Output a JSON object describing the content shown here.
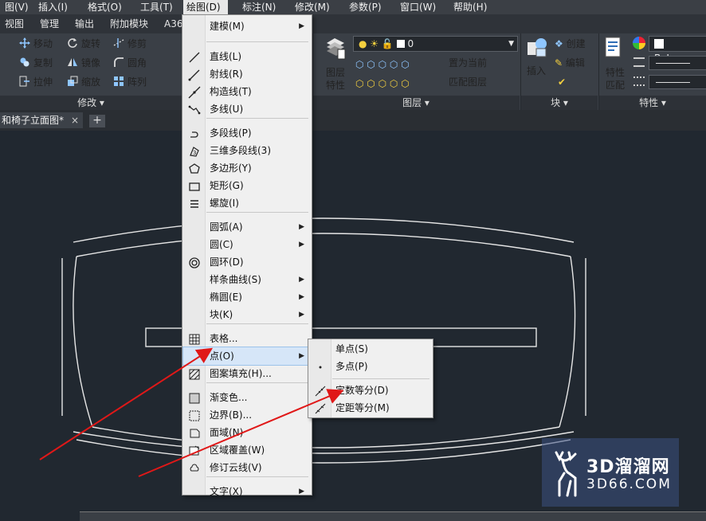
{
  "menubar": {
    "items": [
      "图(V)",
      "插入(I)",
      "格式(O)",
      "工具(T)",
      "绘图(D)",
      "标注(N)",
      "修改(M)",
      "参数(P)",
      "窗口(W)",
      "帮助(H)"
    ]
  },
  "ribbon_tabs": [
    "视图",
    "管理",
    "输出",
    "附加模块",
    "A36"
  ],
  "ribbon": {
    "modify": {
      "move": "移动",
      "rotate": "旋转",
      "trim": "修剪",
      "copy": "复制",
      "mirror": "镜像",
      "fillet": "圆角",
      "stretch": "拉伸",
      "scale": "缩放",
      "array": "阵列",
      "panel_label": "修改 ▾"
    },
    "layers": {
      "layer_props": "图层\n特性",
      "layer_props_l1": "图层",
      "layer_props_l2": "特性",
      "current_layer": "0",
      "set_current": "置为当前",
      "match_layer": "匹配图层",
      "panel_label": "图层 ▾"
    },
    "block": {
      "insert": "插入",
      "create": "创建",
      "edit": "编辑",
      "panel_label": "块 ▾"
    },
    "properties": {
      "match_l1": "特性",
      "match_l2": "匹配",
      "bylayer": "ByLaye",
      "panel_label": "特性 ▾"
    }
  },
  "doc": {
    "tab_title": "和椅子立面图*",
    "close": "×",
    "new_tab": "+"
  },
  "draw_menu": {
    "items": [
      {
        "label": "建模(M)",
        "submenu": true,
        "icon": "none"
      },
      {
        "label": "直线(L)",
        "icon": "line-icon"
      },
      {
        "label": "射线(R)",
        "icon": "ray-icon"
      },
      {
        "label": "构造线(T)",
        "icon": "xline-icon"
      },
      {
        "label": "多线(U)",
        "icon": "multiline-icon"
      },
      {
        "label": "多段线(P)",
        "icon": "polyline-icon"
      },
      {
        "label": "三维多段线(3)",
        "icon": "3d-polyline-icon"
      },
      {
        "label": "多边形(Y)",
        "icon": "polygon-icon"
      },
      {
        "label": "矩形(G)",
        "icon": "rectangle-icon"
      },
      {
        "label": "螺旋(I)",
        "icon": "helix-icon"
      },
      {
        "label": "圆弧(A)",
        "submenu": true,
        "icon": "none"
      },
      {
        "label": "圆(C)",
        "submenu": true,
        "icon": "none"
      },
      {
        "label": "圆环(D)",
        "icon": "donut-icon"
      },
      {
        "label": "样条曲线(S)",
        "submenu": true,
        "icon": "none"
      },
      {
        "label": "椭圆(E)",
        "submenu": true,
        "icon": "none"
      },
      {
        "label": "块(K)",
        "submenu": true,
        "icon": "none"
      },
      {
        "label": "表格...",
        "icon": "table-icon"
      },
      {
        "label": "点(O)",
        "submenu": true,
        "highlighted": true,
        "icon": "none"
      },
      {
        "label": "图案填充(H)...",
        "icon": "hatch-icon"
      },
      {
        "label": "渐变色...",
        "icon": "gradient-icon"
      },
      {
        "label": "边界(B)...",
        "icon": "boundary-icon"
      },
      {
        "label": "面域(N)",
        "icon": "region-icon"
      },
      {
        "label": "区域覆盖(W)",
        "icon": "wipeout-icon"
      },
      {
        "label": "修订云线(V)",
        "icon": "revcloud-icon"
      },
      {
        "label": "文字(X)",
        "submenu": true,
        "icon": "none"
      }
    ]
  },
  "point_submenu": {
    "items": [
      {
        "label": "单点(S)",
        "icon": "none"
      },
      {
        "label": "多点(P)",
        "icon": "multiple-points-icon"
      },
      {
        "label": "定数等分(D)",
        "icon": "divide-icon"
      },
      {
        "label": "定距等分(M)",
        "icon": "measure-icon"
      }
    ]
  },
  "annotation_color": "#e01818",
  "watermark": {
    "brand": "3D溜溜网",
    "url": "3D66.COM"
  }
}
